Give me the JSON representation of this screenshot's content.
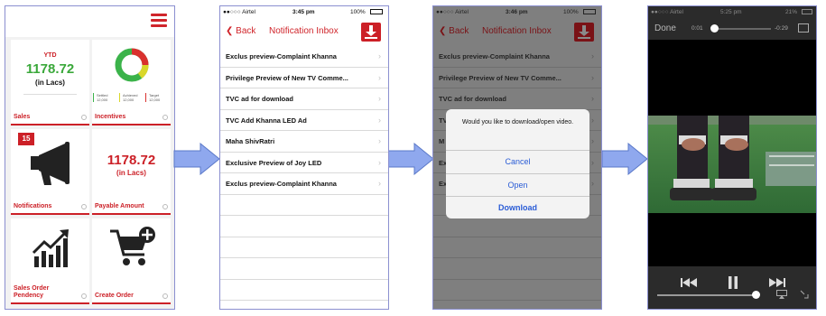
{
  "screen1": {
    "ytd_label": "YTD",
    "sales_value": "1178.72",
    "sales_unit": "(in Lacs)",
    "incentives_legend": [
      "Settled",
      "12,000",
      "Achieved",
      "12,000",
      "Target",
      "12,000"
    ],
    "notification_count": "15",
    "payable_value": "1178.72",
    "payable_unit": "(in Lacs)",
    "tiles": [
      "Sales",
      "Incentives",
      "Notifications",
      "Payable Amount",
      "Sales Order Pendency",
      "Create Order"
    ],
    "colors": {
      "accent": "#cc2027",
      "green": "#3aa83a",
      "donut_red": "#d9312e",
      "donut_yellow": "#d9d72a",
      "donut_green": "#3bb34a"
    }
  },
  "screen2": {
    "carrier": "●●○○○ Airtel",
    "time": "3:45 pm",
    "battery": "100%",
    "back_label": "Back",
    "title": "Notification Inbox",
    "items": [
      "Exclus preview-Complaint Khanna",
      "Privilege Preview of New TV Comme...",
      "TVC ad for download",
      "TVC Add Khanna LED Ad",
      "Maha ShivRatri",
      "Exclusive Preview of Joy LED",
      "Exclus preview-Complaint Khanna"
    ]
  },
  "screen3": {
    "carrier": "●●○○○ Airtel",
    "time": "3:46 pm",
    "battery": "100%",
    "back_label": "Back",
    "title": "Notification Inbox",
    "items": [
      "Exclus preview-Complaint Khanna",
      "Privilege Preview of New TV Comme...",
      "TVC ad for download",
      "TV",
      "M",
      "Exc",
      "Ex"
    ],
    "alert": {
      "message": "Would you like to download/open video.",
      "cancel": "Cancel",
      "open": "Open",
      "download": "Download"
    }
  },
  "screen4": {
    "carrier": "●●○○○ Airtel",
    "time": "5:25 pm",
    "battery": "21%",
    "done_label": "Done",
    "elapsed": "0:01",
    "remaining": "-0:29",
    "playback_progress": 0.04,
    "volume_level": 0.97
  },
  "arrow_color": "#8fa8ee"
}
